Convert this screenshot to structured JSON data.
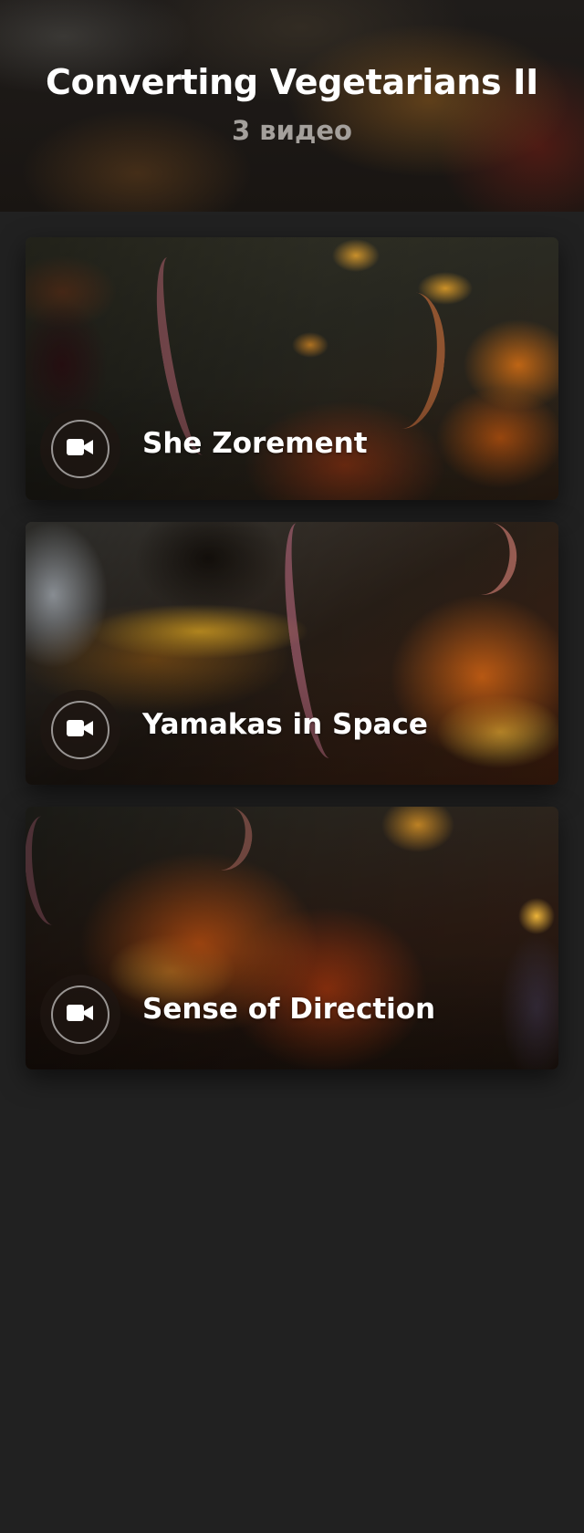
{
  "header": {
    "title": "Converting Vegetarians II",
    "subtitle": "3 видео"
  },
  "videos": [
    {
      "title": "She Zorement",
      "icon": "video-camera-icon"
    },
    {
      "title": "Yamakas in Space",
      "icon": "video-camera-icon"
    },
    {
      "title": "Sense of Direction",
      "icon": "video-camera-icon"
    }
  ],
  "colors": {
    "background": "#212121",
    "text_primary": "#ffffff",
    "text_secondary": "#a4a09c"
  }
}
